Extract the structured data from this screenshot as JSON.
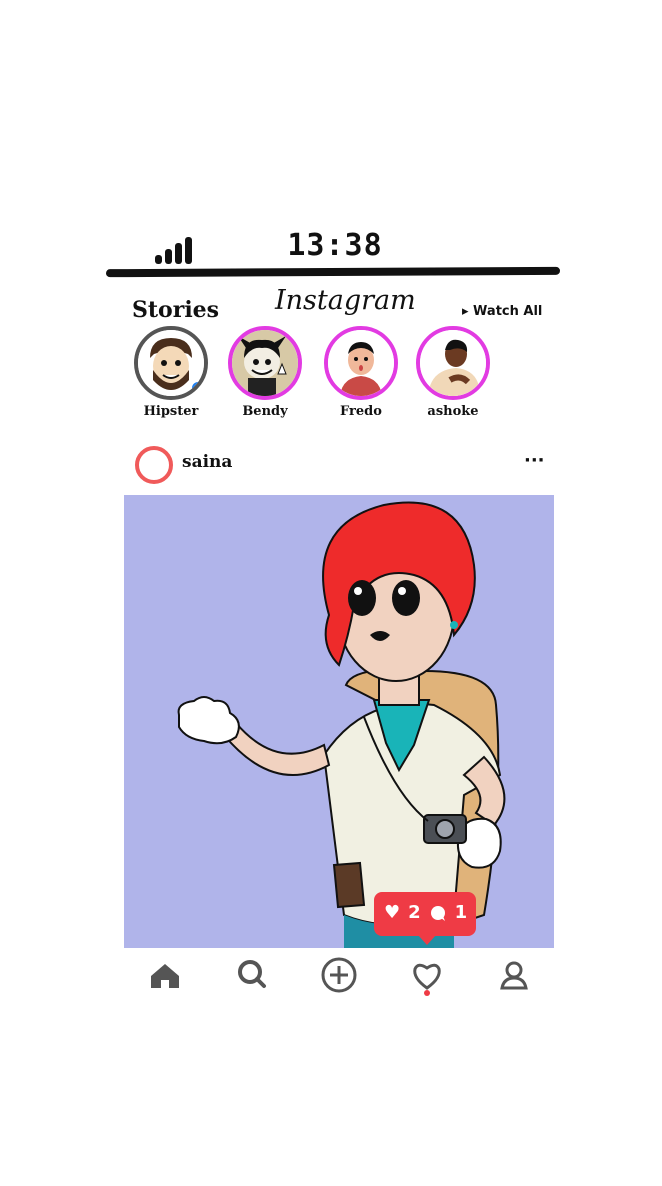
{
  "status_bar": {
    "time": "13:38"
  },
  "header": {
    "stories_title": "Stories",
    "app_title": "Instagram",
    "watch_all": "▸ Watch All"
  },
  "stories": [
    {
      "name": "Hipster",
      "seen": true
    },
    {
      "name": "Bendy",
      "seen": false
    },
    {
      "name": "Fredo",
      "seen": false
    },
    {
      "name": "ashoke",
      "seen": false
    }
  ],
  "post": {
    "username": "saina",
    "more": "···",
    "likes": "2",
    "comments": "1"
  },
  "nav": [
    "home-icon",
    "search-icon",
    "add-icon",
    "heart-icon",
    "profile-icon"
  ],
  "colors": {
    "story_ring": "#e23be2",
    "accent_red": "#ef3b45",
    "post_bg": "#b0b4ea",
    "live_dot": "#1e7ff0"
  }
}
